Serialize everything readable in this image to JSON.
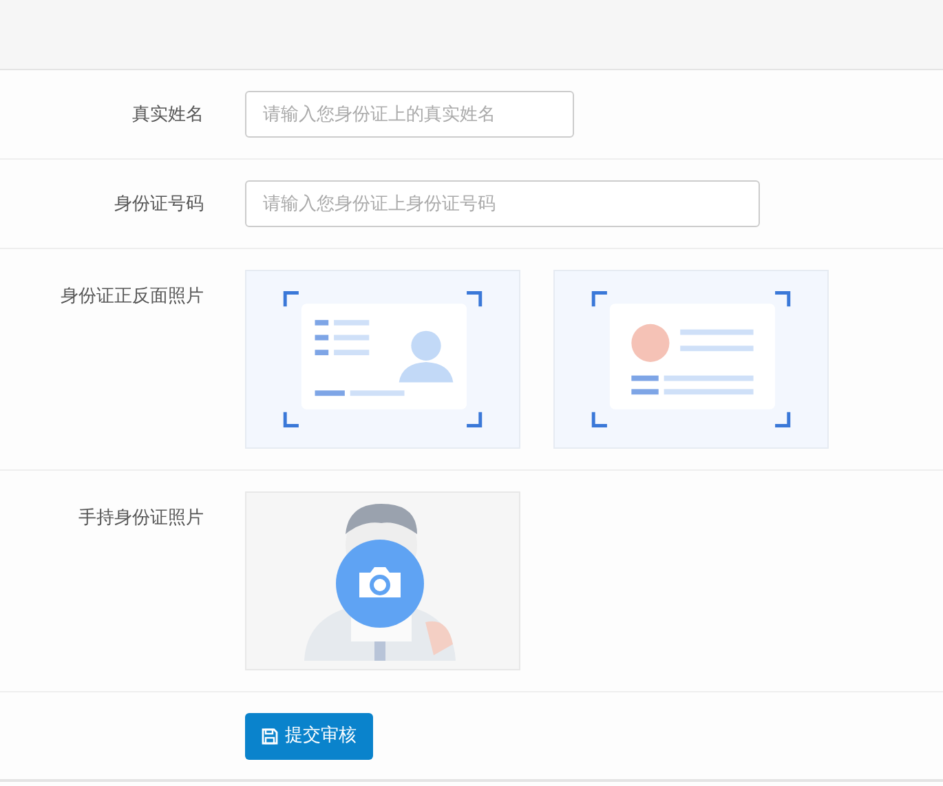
{
  "fields": [
    {
      "label": "真实姓名",
      "kind": "text",
      "placeholder": "请输入您身份证上的真实姓名"
    },
    {
      "label": "身份证号码",
      "kind": "text",
      "placeholder": "请输入您身份证上身份证号码"
    },
    {
      "label": "身份证正反面照片",
      "kind": "id-photos"
    },
    {
      "label": "手持身份证照片",
      "kind": "handheld-photo"
    }
  ],
  "submit_button": {
    "label": "提交审核"
  }
}
